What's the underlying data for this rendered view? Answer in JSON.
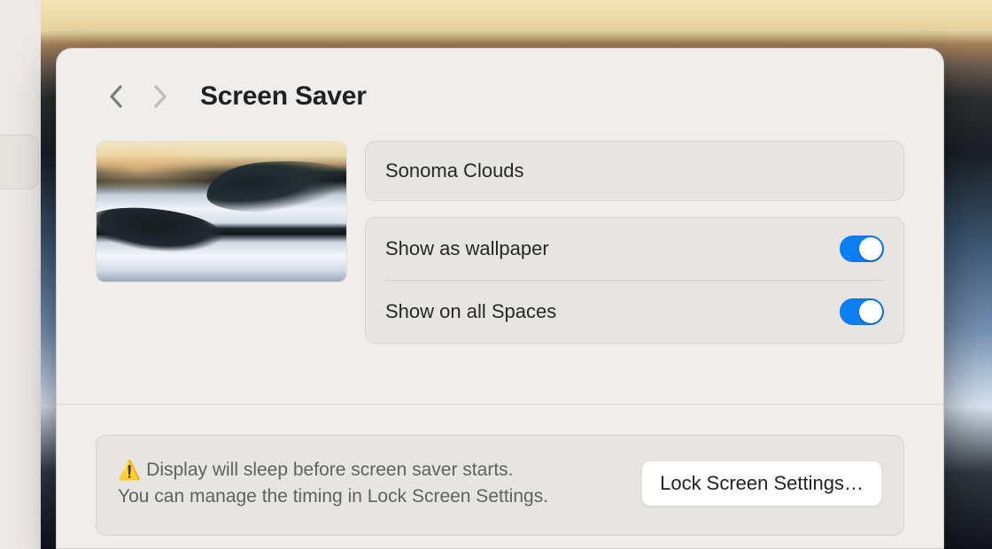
{
  "header": {
    "title": "Screen Saver"
  },
  "screensaver": {
    "name": "Sonoma Clouds"
  },
  "options": {
    "show_as_wallpaper": {
      "label": "Show as wallpaper",
      "value": true
    },
    "show_on_all_spaces": {
      "label": "Show on all Spaces",
      "value": true
    }
  },
  "warning": {
    "line1": "Display will sleep before screen saver starts.",
    "line2": "You can manage the timing in Lock Screen Settings.",
    "button_label": "Lock Screen Settings…"
  },
  "colors": {
    "accent": "#0a7ef2",
    "panel_bg": "#efeeec",
    "card_bg": "#e7e5e2"
  }
}
